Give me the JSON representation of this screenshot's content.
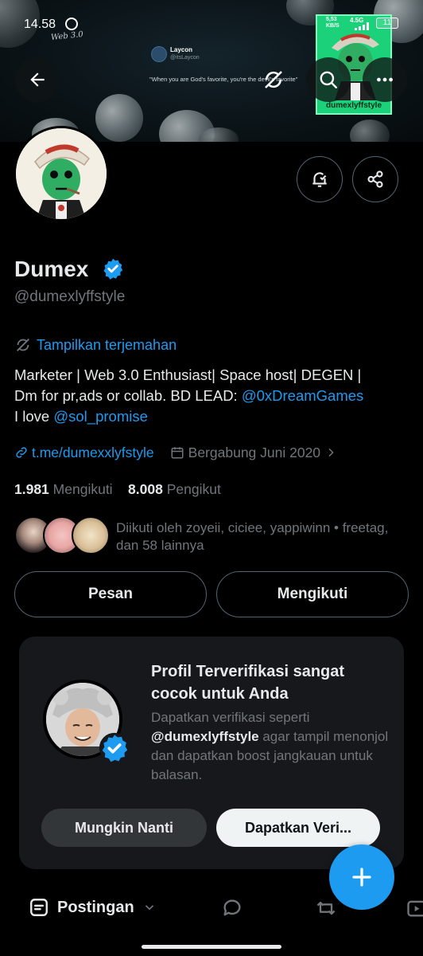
{
  "status_bar": {
    "time": "14.58",
    "net_speed": "5,53",
    "net_unit": "KB/S",
    "net_type": "4.5G",
    "battery": "11"
  },
  "banner": {
    "tweet_name": "Laycon",
    "tweet_handle": "@itsLaycon",
    "tweet_text": "\"When you are God's favorite, you're the devil's favorite\"",
    "handwritten": "Web 3.0",
    "nft_label": "dumexlyffstyle"
  },
  "profile": {
    "name": "Dumex",
    "handle": "@dumexlyffstyle",
    "translate_label": "Tampilkan terjemahan",
    "bio_line1": "Marketer | Web 3.0 Enthusiast| Space host| DEGEN |",
    "bio_line2_prefix": "Dm for pr,ads or collab. BD LEAD: ",
    "bio_mention1": "@0xDreamGames",
    "bio_line3_prefix": "I love ",
    "bio_mention2": "@sol_promise",
    "website": "t.me/dumexxlyfstyle",
    "joined": "Bergabung Juni 2020",
    "following_count": "1.981",
    "following_label": "Mengikuti",
    "followers_count": "8.008",
    "followers_label": "Pengikut",
    "followed_by": "Diikuti oleh zoyeii, ciciee, yappiwinn • freetag, dan 58 lainnya"
  },
  "actions": {
    "message": "Pesan",
    "following": "Mengikuti"
  },
  "promo": {
    "title": "Profil Terverifikasi sangat cocok untuk Anda",
    "desc_prefix": "Dapatkan verifikasi seperti ",
    "desc_handle": "@dumexlyffstyle",
    "desc_suffix": " agar tampil menonjol dan dapatkan boost jangkauan untuk balasan.",
    "later": "Mungkin Nanti",
    "verify": "Dapatkan Veri..."
  },
  "tabs": {
    "posts": "Postingan"
  },
  "colors": {
    "accent": "#1d9bf0",
    "background": "#000000",
    "muted": "#71767b",
    "card": "#16181c"
  },
  "icons": [
    "back-arrow-icon",
    "search-icon",
    "more-icon",
    "notification-bell-icon",
    "share-icon",
    "translate-icon",
    "link-icon",
    "calendar-icon",
    "verified-badge-icon",
    "compose-plus-icon",
    "reply-icon",
    "repost-icon",
    "media-icon"
  ]
}
